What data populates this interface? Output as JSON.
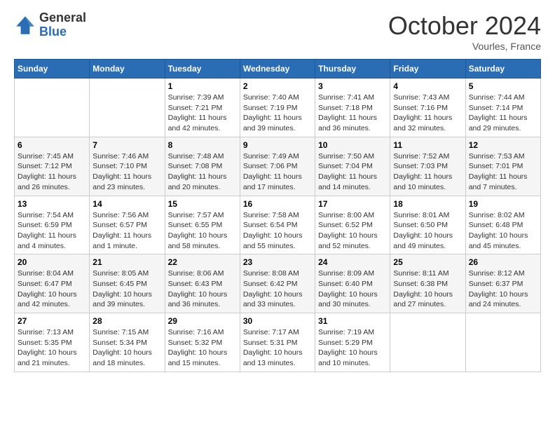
{
  "header": {
    "logo_general": "General",
    "logo_blue": "Blue",
    "month_title": "October 2024",
    "location": "Vourles, France"
  },
  "days_of_week": [
    "Sunday",
    "Monday",
    "Tuesday",
    "Wednesday",
    "Thursday",
    "Friday",
    "Saturday"
  ],
  "weeks": [
    [
      {
        "num": "",
        "info": ""
      },
      {
        "num": "",
        "info": ""
      },
      {
        "num": "1",
        "info": "Sunrise: 7:39 AM\nSunset: 7:21 PM\nDaylight: 11 hours and 42 minutes."
      },
      {
        "num": "2",
        "info": "Sunrise: 7:40 AM\nSunset: 7:19 PM\nDaylight: 11 hours and 39 minutes."
      },
      {
        "num": "3",
        "info": "Sunrise: 7:41 AM\nSunset: 7:18 PM\nDaylight: 11 hours and 36 minutes."
      },
      {
        "num": "4",
        "info": "Sunrise: 7:43 AM\nSunset: 7:16 PM\nDaylight: 11 hours and 32 minutes."
      },
      {
        "num": "5",
        "info": "Sunrise: 7:44 AM\nSunset: 7:14 PM\nDaylight: 11 hours and 29 minutes."
      }
    ],
    [
      {
        "num": "6",
        "info": "Sunrise: 7:45 AM\nSunset: 7:12 PM\nDaylight: 11 hours and 26 minutes."
      },
      {
        "num": "7",
        "info": "Sunrise: 7:46 AM\nSunset: 7:10 PM\nDaylight: 11 hours and 23 minutes."
      },
      {
        "num": "8",
        "info": "Sunrise: 7:48 AM\nSunset: 7:08 PM\nDaylight: 11 hours and 20 minutes."
      },
      {
        "num": "9",
        "info": "Sunrise: 7:49 AM\nSunset: 7:06 PM\nDaylight: 11 hours and 17 minutes."
      },
      {
        "num": "10",
        "info": "Sunrise: 7:50 AM\nSunset: 7:04 PM\nDaylight: 11 hours and 14 minutes."
      },
      {
        "num": "11",
        "info": "Sunrise: 7:52 AM\nSunset: 7:03 PM\nDaylight: 11 hours and 10 minutes."
      },
      {
        "num": "12",
        "info": "Sunrise: 7:53 AM\nSunset: 7:01 PM\nDaylight: 11 hours and 7 minutes."
      }
    ],
    [
      {
        "num": "13",
        "info": "Sunrise: 7:54 AM\nSunset: 6:59 PM\nDaylight: 11 hours and 4 minutes."
      },
      {
        "num": "14",
        "info": "Sunrise: 7:56 AM\nSunset: 6:57 PM\nDaylight: 11 hours and 1 minute."
      },
      {
        "num": "15",
        "info": "Sunrise: 7:57 AM\nSunset: 6:55 PM\nDaylight: 10 hours and 58 minutes."
      },
      {
        "num": "16",
        "info": "Sunrise: 7:58 AM\nSunset: 6:54 PM\nDaylight: 10 hours and 55 minutes."
      },
      {
        "num": "17",
        "info": "Sunrise: 8:00 AM\nSunset: 6:52 PM\nDaylight: 10 hours and 52 minutes."
      },
      {
        "num": "18",
        "info": "Sunrise: 8:01 AM\nSunset: 6:50 PM\nDaylight: 10 hours and 49 minutes."
      },
      {
        "num": "19",
        "info": "Sunrise: 8:02 AM\nSunset: 6:48 PM\nDaylight: 10 hours and 45 minutes."
      }
    ],
    [
      {
        "num": "20",
        "info": "Sunrise: 8:04 AM\nSunset: 6:47 PM\nDaylight: 10 hours and 42 minutes."
      },
      {
        "num": "21",
        "info": "Sunrise: 8:05 AM\nSunset: 6:45 PM\nDaylight: 10 hours and 39 minutes."
      },
      {
        "num": "22",
        "info": "Sunrise: 8:06 AM\nSunset: 6:43 PM\nDaylight: 10 hours and 36 minutes."
      },
      {
        "num": "23",
        "info": "Sunrise: 8:08 AM\nSunset: 6:42 PM\nDaylight: 10 hours and 33 minutes."
      },
      {
        "num": "24",
        "info": "Sunrise: 8:09 AM\nSunset: 6:40 PM\nDaylight: 10 hours and 30 minutes."
      },
      {
        "num": "25",
        "info": "Sunrise: 8:11 AM\nSunset: 6:38 PM\nDaylight: 10 hours and 27 minutes."
      },
      {
        "num": "26",
        "info": "Sunrise: 8:12 AM\nSunset: 6:37 PM\nDaylight: 10 hours and 24 minutes."
      }
    ],
    [
      {
        "num": "27",
        "info": "Sunrise: 7:13 AM\nSunset: 5:35 PM\nDaylight: 10 hours and 21 minutes."
      },
      {
        "num": "28",
        "info": "Sunrise: 7:15 AM\nSunset: 5:34 PM\nDaylight: 10 hours and 18 minutes."
      },
      {
        "num": "29",
        "info": "Sunrise: 7:16 AM\nSunset: 5:32 PM\nDaylight: 10 hours and 15 minutes."
      },
      {
        "num": "30",
        "info": "Sunrise: 7:17 AM\nSunset: 5:31 PM\nDaylight: 10 hours and 13 minutes."
      },
      {
        "num": "31",
        "info": "Sunrise: 7:19 AM\nSunset: 5:29 PM\nDaylight: 10 hours and 10 minutes."
      },
      {
        "num": "",
        "info": ""
      },
      {
        "num": "",
        "info": ""
      }
    ]
  ]
}
